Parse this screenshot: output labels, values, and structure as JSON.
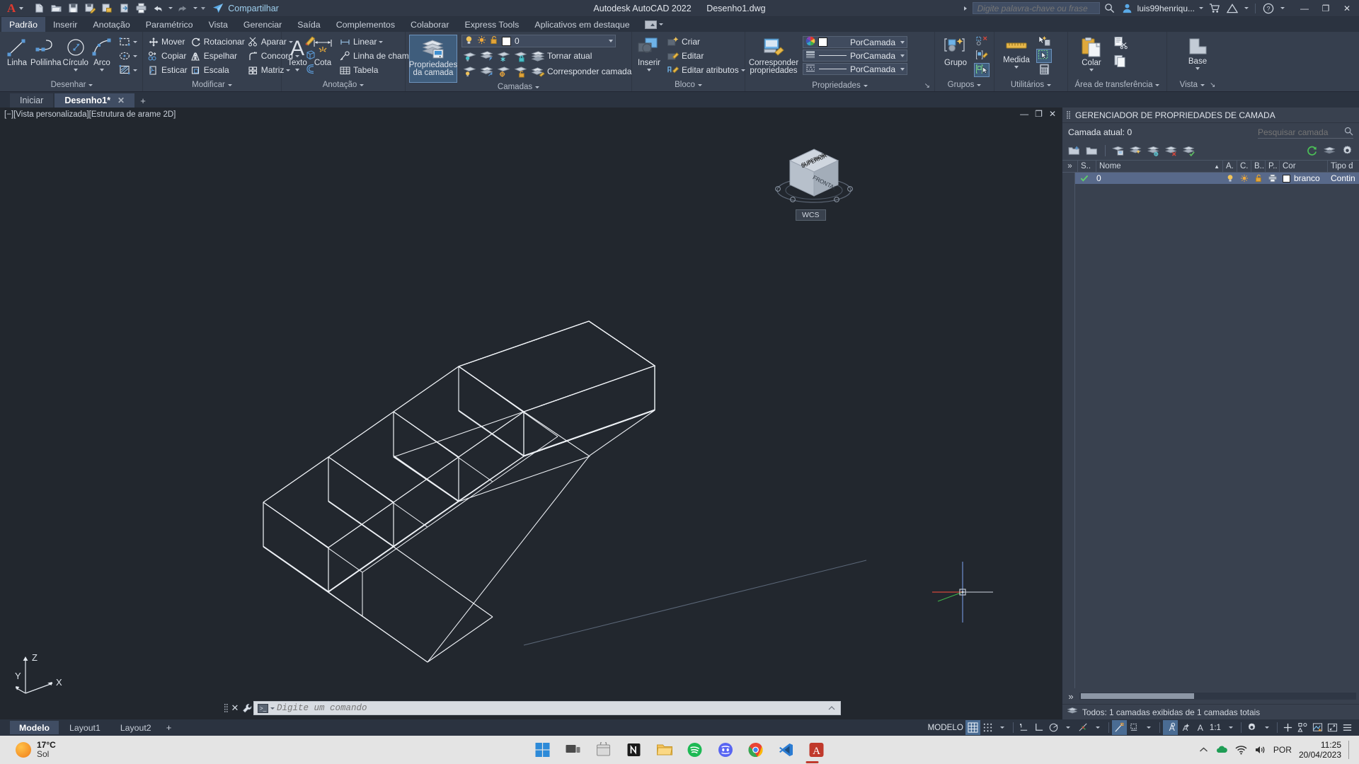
{
  "titlebar": {
    "logo": "A",
    "quick_access": [
      {
        "name": "new-file-icon",
        "label": "Novo"
      },
      {
        "name": "open-folder-icon",
        "label": "Abrir"
      },
      {
        "name": "save-icon",
        "label": "Salvar"
      },
      {
        "name": "save-as-icon",
        "label": "Salvar como"
      },
      {
        "name": "save-to-web-icon",
        "label": "Salvar na Web e Mobile"
      },
      {
        "name": "open-from-web-icon",
        "label": "Abrir da Web e Mobile"
      },
      {
        "name": "plot-icon",
        "label": "Plotar"
      },
      {
        "name": "undo-icon",
        "label": "Desfazer"
      },
      {
        "name": "redo-icon",
        "label": "Refazer"
      }
    ],
    "share_label": "Compartilhar",
    "app_title": "Autodesk AutoCAD 2022",
    "file_name": "Desenho1.dwg",
    "search_placeholder": "Digite palavra-chave ou frase",
    "user_name": "luis99henriqu...",
    "window_controls": {
      "minimize": "—",
      "restore": "❐",
      "close": "✕"
    }
  },
  "ribbon_tabs": {
    "items": [
      {
        "label": "Padrão",
        "active": true
      },
      {
        "label": "Inserir",
        "active": false
      },
      {
        "label": "Anotação",
        "active": false
      },
      {
        "label": "Paramétrico",
        "active": false
      },
      {
        "label": "Vista",
        "active": false
      },
      {
        "label": "Gerenciar",
        "active": false
      },
      {
        "label": "Saída",
        "active": false
      },
      {
        "label": "Complementos",
        "active": false
      },
      {
        "label": "Colaborar",
        "active": false
      },
      {
        "label": "Express Tools",
        "active": false
      },
      {
        "label": "Aplicativos em destaque",
        "active": false
      }
    ]
  },
  "ribbon": {
    "desenhar": {
      "title": "Desenhar",
      "big": [
        {
          "label": "Linha",
          "icon": "line-icon"
        },
        {
          "label": "Polilinha",
          "icon": "polyline-icon"
        },
        {
          "label": "Círculo",
          "icon": "circle-icon",
          "has_caret": true
        },
        {
          "label": "Arco",
          "icon": "arc-icon",
          "has_caret": true
        }
      ],
      "small": [
        {
          "icon": "rectangle-icon",
          "has_caret": true
        },
        {
          "icon": "ellipse-icon",
          "has_caret": true
        },
        {
          "icon": "hatch-icon",
          "has_caret": true
        }
      ]
    },
    "modificar": {
      "title": "Modificar",
      "rows": [
        [
          {
            "label": "Mover",
            "icon": "move-icon"
          },
          {
            "label": "Rotacionar",
            "icon": "rotate-icon"
          },
          {
            "label": "Aparar",
            "icon": "trim-icon",
            "has_caret": true
          }
        ],
        [
          {
            "label": "Copiar",
            "icon": "copy-icon"
          },
          {
            "label": "Espelhar",
            "icon": "mirror-icon"
          },
          {
            "label": "Concord",
            "icon": "fillet-icon",
            "has_caret": true
          }
        ],
        [
          {
            "label": "Esticar",
            "icon": "stretch-icon"
          },
          {
            "label": "Escala",
            "icon": "scale-icon"
          },
          {
            "label": "Matriz",
            "icon": "array-icon",
            "has_caret": true
          }
        ]
      ],
      "extra": [
        {
          "icon": "edit-polyline-icon"
        },
        {
          "icon": "3d-solid-icon"
        },
        {
          "icon": "offset-icon"
        }
      ]
    },
    "anotacao": {
      "title": "Anotação",
      "big": [
        {
          "label": "Texto",
          "icon": "text-icon",
          "has_caret": true
        },
        {
          "label": "Cota",
          "icon": "dimension-icon"
        }
      ],
      "small": [
        {
          "label": "Linear",
          "icon": "linear-dim-icon",
          "has_caret": true
        },
        {
          "label": "Linha de chamada",
          "icon": "leader-icon",
          "has_caret": true
        },
        {
          "label": "Tabela",
          "icon": "table-icon"
        }
      ]
    },
    "camadas": {
      "title": "Camadas",
      "big": {
        "label1": "Propriedades",
        "label2": "da camada",
        "icon": "layer-properties-icon",
        "active": true
      },
      "current_layer": "0",
      "icons_row1": [
        {
          "icon": "layer-off-icon"
        },
        {
          "icon": "layer-isolate-icon"
        },
        {
          "icon": "layer-freeze-icon"
        },
        {
          "icon": "layer-lock-icon"
        }
      ],
      "icons_row2": [
        {
          "icon": "layer-on-icon"
        },
        {
          "icon": "layer-unisolate-icon"
        },
        {
          "icon": "layer-thaw-icon"
        },
        {
          "icon": "layer-unlock-icon"
        }
      ],
      "make_current": "Tornar atual",
      "match_layer": "Corresponder camada"
    },
    "bloco": {
      "title": "Bloco",
      "big": {
        "label": "Inserir",
        "icon": "insert-block-icon",
        "has_caret": true
      },
      "small": [
        {
          "label": "Criar",
          "icon": "create-block-icon"
        },
        {
          "label": "Editar",
          "icon": "edit-block-icon"
        },
        {
          "label": "Editar atributos",
          "icon": "edit-attributes-icon",
          "has_caret": true
        }
      ]
    },
    "propriedades": {
      "title": "Propriedades",
      "big": {
        "label1": "Corresponder",
        "label2": "propriedades",
        "icon": "match-properties-icon"
      },
      "combos": [
        {
          "value": "PorCamada",
          "icon": "color-wheel-icon",
          "swatch": "#ffffff"
        },
        {
          "value": "PorCamada",
          "icon": "lineweight-icon"
        },
        {
          "value": "PorCamada",
          "icon": "linetype-icon"
        }
      ]
    },
    "grupos": {
      "title": "Grupos",
      "big": {
        "label": "Grupo",
        "icon": "group-icon"
      },
      "small": [
        {
          "icon": "ungroup-icon"
        },
        {
          "icon": "group-edit-icon"
        },
        {
          "icon": "group-selection-icon",
          "active": true
        }
      ]
    },
    "utilitarios": {
      "title": "Utilitários",
      "big": {
        "label": "Medida",
        "icon": "measure-icon",
        "has_caret": true
      },
      "small": [
        {
          "icon": "quick-select-icon"
        },
        {
          "icon": "select-all-icon",
          "active": true
        },
        {
          "icon": "calculator-icon"
        }
      ]
    },
    "area_transferencia": {
      "title": "Área de transferência",
      "big": {
        "label": "Colar",
        "icon": "paste-icon",
        "has_caret": true
      },
      "small": [
        {
          "icon": "cut-icon"
        },
        {
          "icon": "copy-clip-icon"
        }
      ]
    },
    "vista": {
      "title": "Vista",
      "big": {
        "label": "Base",
        "icon": "base-view-icon",
        "has_caret": true
      }
    }
  },
  "doc_tabs": {
    "items": [
      {
        "label": "Iniciar",
        "active": false,
        "closable": false
      },
      {
        "label": "Desenho1*",
        "active": true,
        "closable": true
      }
    ],
    "add_label": "+"
  },
  "viewport": {
    "label": "[−][Vista personalizada][Estrutura de arame 2D]",
    "controls": [
      "minimize",
      "restore",
      "close"
    ],
    "viewcube": {
      "top_face": "SUPERIOR",
      "front_face": "FRONTAL",
      "wcs_label": "WCS"
    },
    "ucs_axes": {
      "z": "Z",
      "y": "Y",
      "x": "X"
    },
    "drawing_description": "Isometric wireframe of a staircase with 5 steps"
  },
  "command_line": {
    "placeholder": "Digite um comando",
    "value": "",
    "close_icon": "✕",
    "customize_icon": "wrench-icon"
  },
  "layer_palette": {
    "title": "GERENCIADOR DE PROPRIEDADES DE CAMADA",
    "current_layer_label": "Camada atual: 0",
    "search_placeholder": "Pesquisar camada",
    "toolbar": [
      {
        "icon": "new-layer-icon"
      },
      {
        "icon": "new-layer-vp-frozen-icon"
      },
      {
        "icon": "delete-layer-icon"
      },
      {
        "icon": "set-current-icon"
      },
      {
        "icon": "layer-state-icon"
      },
      {
        "icon": "layer-filter-icon"
      },
      {
        "icon": "refresh-icon"
      },
      {
        "icon": "layer-states-manager-icon"
      },
      {
        "icon": "settings-gear-icon"
      }
    ],
    "columns": [
      "S..",
      "Nome",
      "A.",
      "C.",
      "B..",
      "P..",
      "Cor",
      "Tipo d"
    ],
    "rows": [
      {
        "status": "current",
        "name": "0",
        "on": "on",
        "freeze": "thaw",
        "lock": "unlocked",
        "plot": "plot",
        "color": "branco",
        "linetype": "Contin"
      }
    ],
    "status_text": "Todos: 1 camadas exibidas de 1 camadas totais"
  },
  "layout_bar": {
    "tabs": [
      {
        "label": "Modelo",
        "active": true
      },
      {
        "label": "Layout1",
        "active": false
      },
      {
        "label": "Layout2",
        "active": false
      }
    ],
    "add_label": "+"
  },
  "status_bar": {
    "space_label": "MODELO",
    "items": [
      {
        "name": "grid-display",
        "label": "",
        "active": true
      },
      {
        "name": "snap-mode",
        "label": "",
        "active": false,
        "has_caret": true
      },
      {
        "name": "infer-constraints",
        "label": "",
        "active": false
      },
      {
        "name": "ortho-mode",
        "label": "",
        "active": false
      },
      {
        "name": "polar-tracking",
        "label": "",
        "active": false,
        "has_caret": true
      },
      {
        "name": "object-snap",
        "label": "",
        "active": false,
        "has_caret": true
      },
      {
        "name": "object-snap-tracking",
        "label": "",
        "active": true
      },
      {
        "name": "dynamic-ucs",
        "label": "",
        "active": false,
        "has_caret": true
      },
      {
        "name": "annotation-visibility",
        "label": "",
        "active": true
      },
      {
        "name": "autoscale",
        "label": "",
        "active": false
      },
      {
        "name": "annotation-scale-icon",
        "label": "",
        "active": false
      },
      {
        "name": "annotation-scale",
        "label": "1:1",
        "active": false,
        "has_caret": true
      },
      {
        "name": "workspace-switching",
        "label": "",
        "active": false,
        "has_caret": true
      },
      {
        "name": "hardware-acceleration",
        "label": "",
        "active": false
      },
      {
        "name": "isolate-objects",
        "label": "",
        "active": false
      },
      {
        "name": "graphics-performance",
        "label": "",
        "active": false
      },
      {
        "name": "clean-screen",
        "label": "",
        "active": false
      },
      {
        "name": "customization",
        "label": "",
        "active": false
      }
    ]
  },
  "taskbar": {
    "weather": {
      "temp": "17°C",
      "condition": "Sol"
    },
    "apps": [
      {
        "name": "start-windows-icon"
      },
      {
        "name": "task-view-icon"
      },
      {
        "name": "microsoft-store-icon"
      },
      {
        "name": "notion-icon"
      },
      {
        "name": "file-explorer-icon"
      },
      {
        "name": "spotify-icon"
      },
      {
        "name": "discord-icon"
      },
      {
        "name": "google-chrome-icon"
      },
      {
        "name": "vscode-icon"
      },
      {
        "name": "autocad-icon"
      }
    ],
    "tray": {
      "chevron": "︿",
      "language": "POR",
      "time": "11:25",
      "date": "20/04/2023"
    }
  }
}
